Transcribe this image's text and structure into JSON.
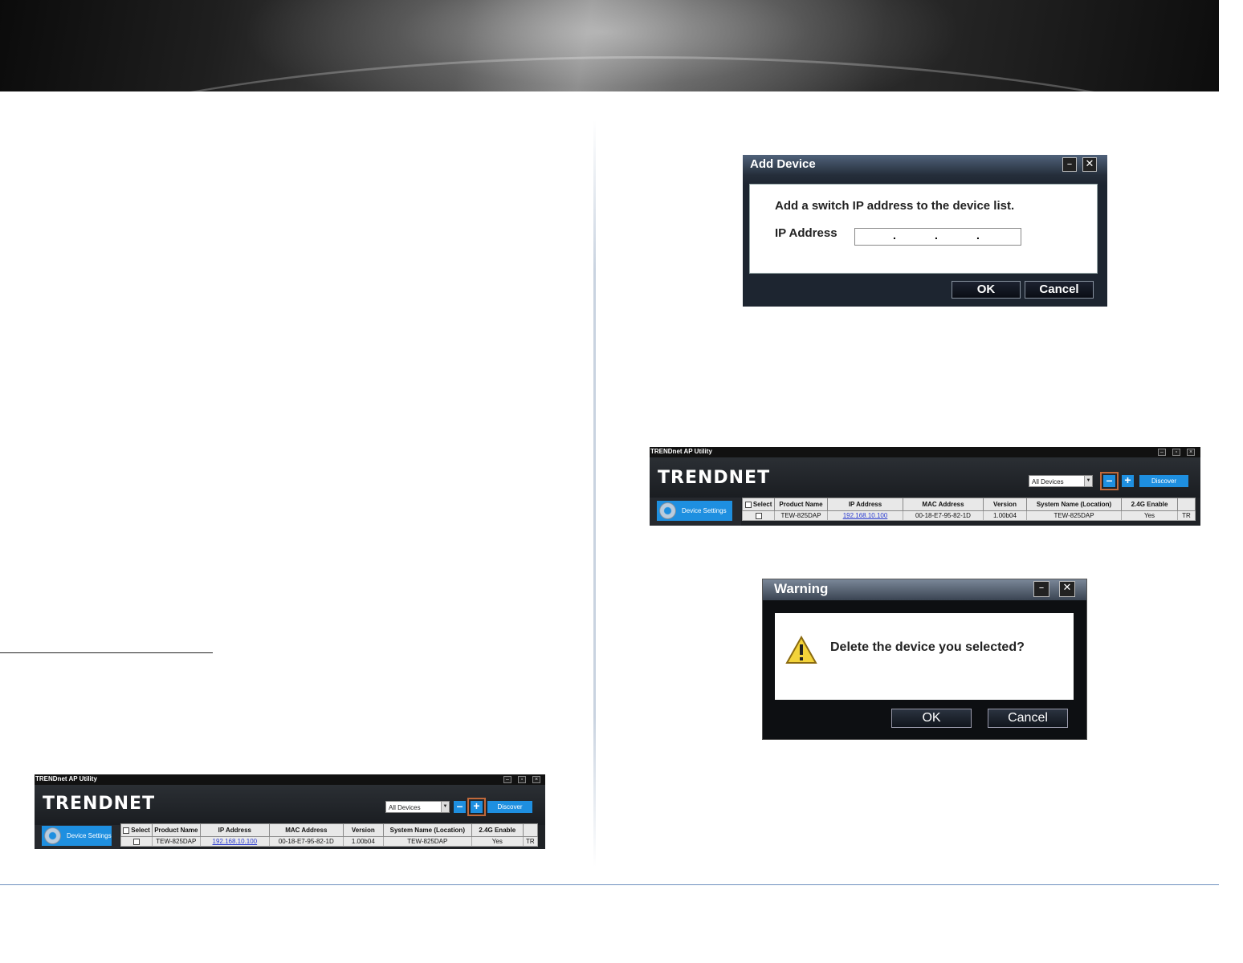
{
  "add_device_dialog": {
    "title": "Add Device",
    "message": "Add a switch IP address to the device list.",
    "ip_label": "IP Address",
    "ok": "OK",
    "cancel": "Cancel"
  },
  "warning_dialog": {
    "title": "Warning",
    "message": "Delete the device you selected?",
    "ok": "OK",
    "cancel": "Cancel"
  },
  "ap_utility": {
    "window_title": "TRENDnet AP Utility",
    "logo": "TRENDNET",
    "filter": "All Devices",
    "discover": "Discover",
    "device_settings": "Device Settings",
    "columns": [
      "Select",
      "Product Name",
      "IP Address",
      "MAC Address",
      "Version",
      "System Name (Location)",
      "2.4G Enable"
    ],
    "row": {
      "product_name": "TEW-825DAP",
      "ip_address": "192.168.10.100",
      "mac_address": "00-18-E7-95-82-1D",
      "version": "1.00b04",
      "system_name": "TEW-825DAP",
      "enable_24g": "Yes",
      "overflow": "TR"
    }
  },
  "colors": {
    "accent_blue": "#1e8fe0",
    "highlight_box": "#c0683a",
    "ip_link": "#2a3bd0",
    "footer_rule": "#6e8fbf"
  }
}
